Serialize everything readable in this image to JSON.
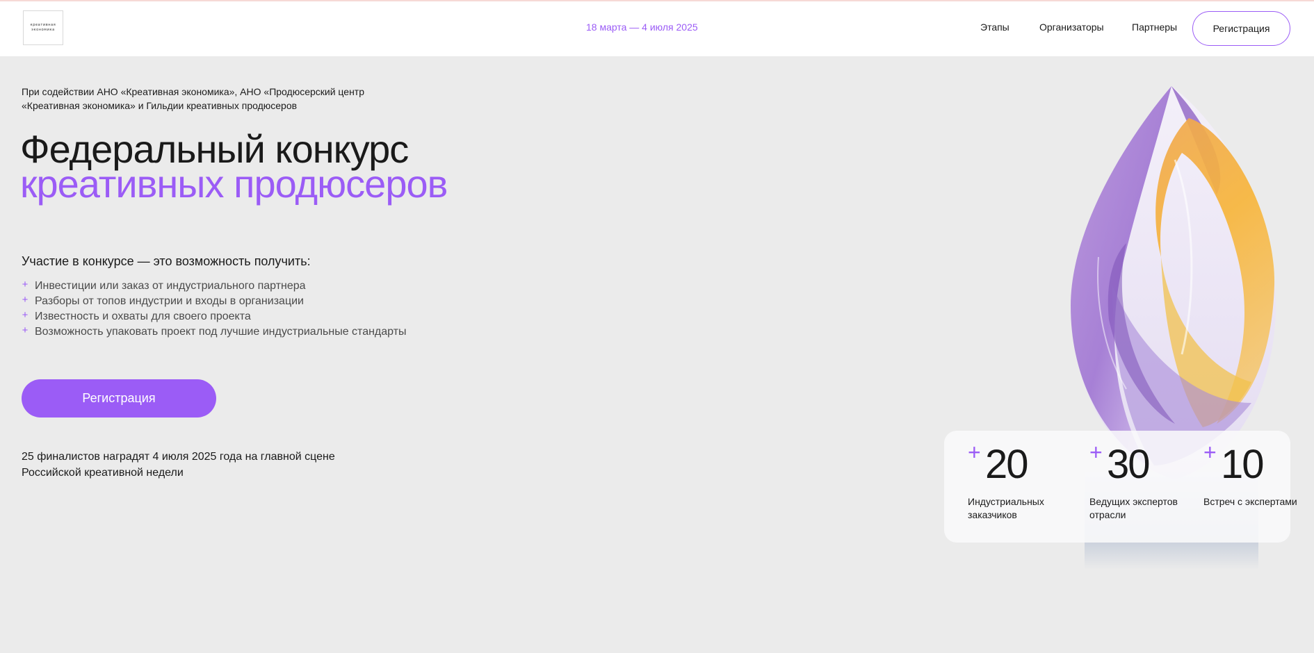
{
  "header": {
    "logo_line1": "креативная",
    "logo_line2": "экономика",
    "dates": "18 марта — 4 июля 2025",
    "nav": {
      "stages": "Этапы",
      "organizers": "Организаторы",
      "partners": "Партнеры"
    },
    "register_label": "Регистрация"
  },
  "hero": {
    "support_text": "При содействии АНО «Креативная экономика», АНО «Продюсерский центр «Креативная экономика» и Гильдии креативных продюсеров",
    "title_line1": "Федеральный конкурс",
    "title_line2": "креативных продюсеров",
    "benefits_title": "Участие в конкурсе — это возможность получить:",
    "benefits": [
      "Инвестиции или заказ от индустриального партнера",
      "Разборы от топов индустрии и входы в организации",
      "Известность и охваты для своего проекта",
      "Возможность упаковать проект под лучшие индустриальные стандарты"
    ],
    "register_label": "Регистрация",
    "finalists_text": "25 финалистов наградят 4 июля 2025 года на главной сцене Российской креативной недели"
  },
  "stats": [
    {
      "plus": "+",
      "value": "20",
      "label": "Индустриальных заказчиков"
    },
    {
      "plus": "+",
      "value": "30",
      "label": "Ведущих экспертов отрасли"
    },
    {
      "plus": "+",
      "value": "10",
      "label": "Встреч с экспертами"
    }
  ],
  "colors": {
    "accent": "#9b5cf6",
    "text": "#1a1a1a",
    "background": "#ebebeb",
    "header_bg": "#ffffff"
  }
}
